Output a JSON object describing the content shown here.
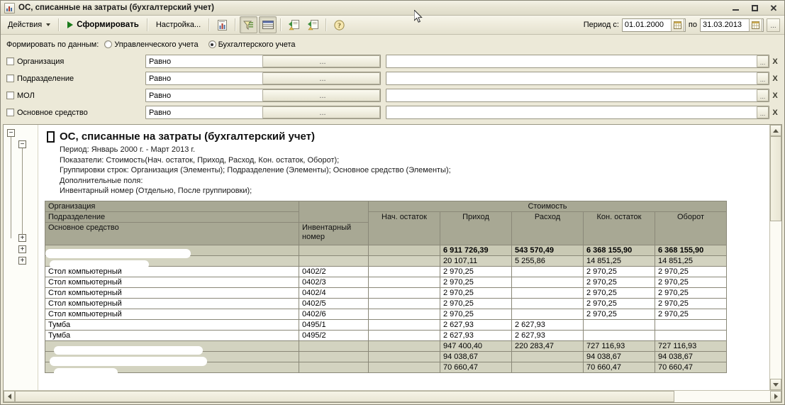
{
  "window": {
    "title": "ОС, списанные на затраты (бухгалтерский учет)",
    "icon": "report-chart-icon",
    "minimize": "−",
    "maximize": "□",
    "close": "✕"
  },
  "toolbar": {
    "actions_label": "Действия",
    "generate_label": "Сформировать",
    "settings_label": "Настройка...",
    "buttons": [
      {
        "name": "report-chart-icon",
        "tip": "Показать диаграмму"
      },
      {
        "name": "filter-icon",
        "tip": "Настройка отбора"
      },
      {
        "name": "table-icon",
        "tip": "Табличный вид"
      },
      {
        "name": "export-save-icon",
        "tip": "Сохранить"
      },
      {
        "name": "export-open-icon",
        "tip": "Открыть"
      },
      {
        "name": "help-icon",
        "tip": "Справка"
      }
    ],
    "period_label": "Период с:",
    "period_from": "01.01.2000",
    "period_to": "31.03.2013",
    "period_to_label": "по",
    "period_more": "..."
  },
  "settings": {
    "mode_label": "Формировать по данным:",
    "modes": [
      {
        "label": "Управленческого учета",
        "selected": false
      },
      {
        "label": "Бухгалтерского учета",
        "selected": true
      }
    ],
    "filters": [
      {
        "label": "Организация",
        "checked": false,
        "comparison": "Равно",
        "value": "",
        "ellipsis": "...",
        "clear": "X"
      },
      {
        "label": "Подразделение",
        "checked": false,
        "comparison": "Равно",
        "value": "",
        "ellipsis": "...",
        "clear": "X"
      },
      {
        "label": "МОЛ",
        "checked": false,
        "comparison": "Равно",
        "value": "",
        "ellipsis": "...",
        "clear": "X"
      },
      {
        "label": "Основное средство",
        "checked": false,
        "comparison": "Равно",
        "value": "",
        "ellipsis": "...",
        "clear": "X"
      }
    ]
  },
  "report": {
    "title": "ОС, списанные на затраты (бухгалтерский учет)",
    "lines": [
      "Период: Январь 2000 г. - Март 2013 г.",
      "Показатели: Стоимость(Нач. остаток, Приход, Расход, Кон. остаток, Оборот);",
      "Группировки строк: Организация (Элементы); Подразделение (Элементы); Основное средство (Элементы);",
      "Дополнительные поля:",
      "Инвентарный номер (Отдельно, После группировки);"
    ],
    "header": {
      "row1_name": "Организация",
      "row2_name": "Подразделение",
      "row3_name": "Основное средство",
      "inventory": "Инвентарный номер",
      "measure": "Стоимость",
      "columns": [
        "Нач. остаток",
        "Приход",
        "Расход",
        "Кон. остаток",
        "Оборот"
      ]
    },
    "rows": [
      {
        "kind": "total",
        "name": "",
        "inv": "",
        "redacted": true,
        "values": [
          "",
          "6 911 726,39",
          "543 570,49",
          "6 368 155,90",
          "6 368 155,90"
        ]
      },
      {
        "kind": "grp",
        "name": "",
        "inv": "",
        "redacted": true,
        "values": [
          "",
          "20 107,11",
          "5 255,86",
          "14 851,25",
          "14 851,25"
        ]
      },
      {
        "kind": "item",
        "name": "Стол компьютерный",
        "inv": "0402/2",
        "values": [
          "",
          "2 970,25",
          "",
          "2 970,25",
          "2 970,25"
        ]
      },
      {
        "kind": "item",
        "name": "Стол компьютерный",
        "inv": "0402/3",
        "values": [
          "",
          "2 970,25",
          "",
          "2 970,25",
          "2 970,25"
        ]
      },
      {
        "kind": "item",
        "name": "Стол компьютерный",
        "inv": "0402/4",
        "values": [
          "",
          "2 970,25",
          "",
          "2 970,25",
          "2 970,25"
        ]
      },
      {
        "kind": "item",
        "name": "Стол компьютерный",
        "inv": "0402/5",
        "values": [
          "",
          "2 970,25",
          "",
          "2 970,25",
          "2 970,25"
        ]
      },
      {
        "kind": "item",
        "name": "Стол компьютерный",
        "inv": "0402/6",
        "values": [
          "",
          "2 970,25",
          "",
          "2 970,25",
          "2 970,25"
        ]
      },
      {
        "kind": "item",
        "name": "Тумба",
        "inv": "0495/1",
        "values": [
          "",
          "2 627,93",
          "2 627,93",
          "",
          ""
        ]
      },
      {
        "kind": "item",
        "name": "Тумба",
        "inv": "0495/2",
        "values": [
          "",
          "2 627,93",
          "2 627,93",
          "",
          ""
        ]
      },
      {
        "kind": "sub",
        "name": "",
        "inv": "",
        "redacted": true,
        "values": [
          "",
          "947 400,40",
          "220 283,47",
          "727 116,93",
          "727 116,93"
        ]
      },
      {
        "kind": "sub",
        "name": "",
        "inv": "",
        "redacted": true,
        "values": [
          "",
          "94 038,67",
          "",
          "94 038,67",
          "94 038,67"
        ]
      },
      {
        "kind": "sub",
        "name": "",
        "inv": "",
        "redacted": true,
        "values": [
          "",
          "70 660,47",
          "",
          "70 660,47",
          "70 660,47"
        ]
      }
    ],
    "outline": {
      "collapse": "−",
      "expand": "+"
    }
  },
  "colors": {
    "window_face": "#ece9d8",
    "header_band": "#a8a894",
    "total_row": "#c9c9b4",
    "group_row": "#d3d3c0",
    "accent_green": "#1a7a1a"
  }
}
